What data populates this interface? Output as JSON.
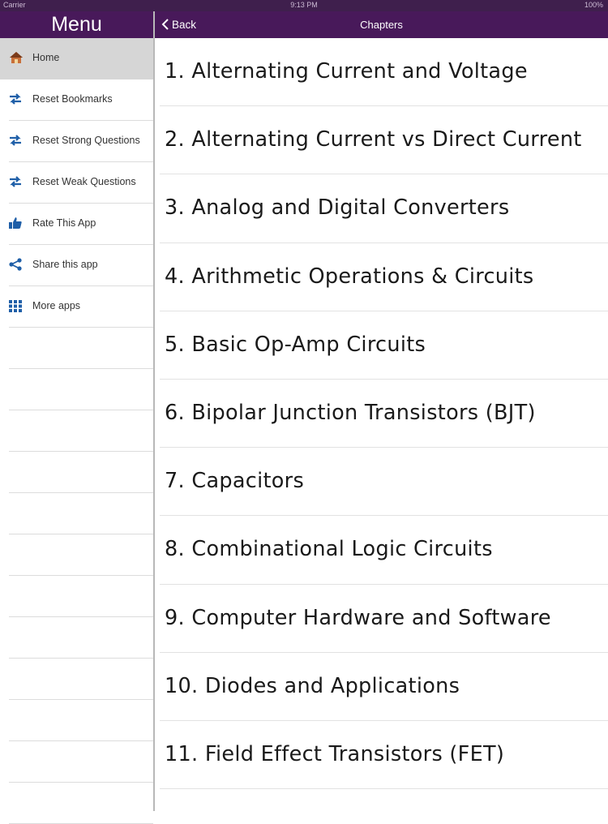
{
  "status_bar": {
    "carrier": "Carrier",
    "time": "9:13 PM",
    "battery": "100%"
  },
  "sidebar": {
    "title": "Menu",
    "items": [
      {
        "label": "Home",
        "icon": "home-icon"
      },
      {
        "label": "Reset Bookmarks",
        "icon": "reset-arrows-icon"
      },
      {
        "label": "Reset Strong Questions",
        "icon": "reset-arrows-icon"
      },
      {
        "label": "Reset Weak Questions",
        "icon": "reset-arrows-icon"
      },
      {
        "label": "Rate This App",
        "icon": "thumbs-up-icon"
      },
      {
        "label": "Share this app",
        "icon": "share-icon"
      },
      {
        "label": "More apps",
        "icon": "grid-icon"
      }
    ]
  },
  "navbar": {
    "back_label": "Back",
    "title": "Chapters"
  },
  "chapters": [
    "1. Alternating Current and Voltage",
    "2. Alternating Current vs Direct Current",
    "3. Analog and Digital Converters",
    "4. Arithmetic Operations & Circuits",
    "5. Basic Op-Amp Circuits",
    "6. Bipolar Junction Transistors (BJT)",
    "7. Capacitors",
    "8. Combinational Logic Circuits",
    "9. Computer Hardware and Software",
    "10. Diodes and Applications",
    "11. Field Effect Transistors (FET)"
  ],
  "colors": {
    "bar_purple": "#48195a",
    "selected_row": "#d6d6d6",
    "icon_blue": "#1f5fa8"
  }
}
